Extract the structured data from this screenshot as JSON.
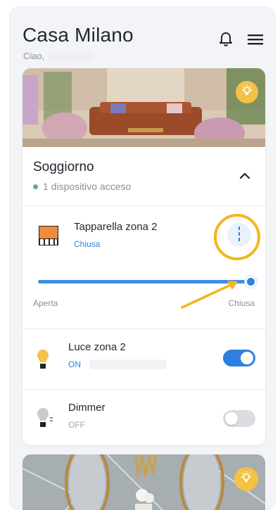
{
  "header": {
    "title": "Casa Milano",
    "greeting": "Ciao,"
  },
  "colors": {
    "accent": "#2f7fe0",
    "active_dot": "#4fb58c",
    "badge": "#f3c247",
    "highlight": "#f5b51e"
  },
  "room": {
    "name": "Soggiorno",
    "status": "1 dispositivo acceso"
  },
  "devices": [
    {
      "name": "Tapparella zona 2",
      "state": "Chiusa",
      "icon": "roller-shutter-icon",
      "slider": {
        "min_label": "Aperta",
        "max_label": "Chiusa",
        "value_fraction": 1.0
      }
    },
    {
      "name": "Luce zona 2",
      "state": "ON",
      "icon": "light-bulb-icon",
      "toggle_on": true
    },
    {
      "name": "Dimmer",
      "state": "OFF",
      "icon": "dimmer-bulb-icon",
      "toggle_on": false
    }
  ]
}
